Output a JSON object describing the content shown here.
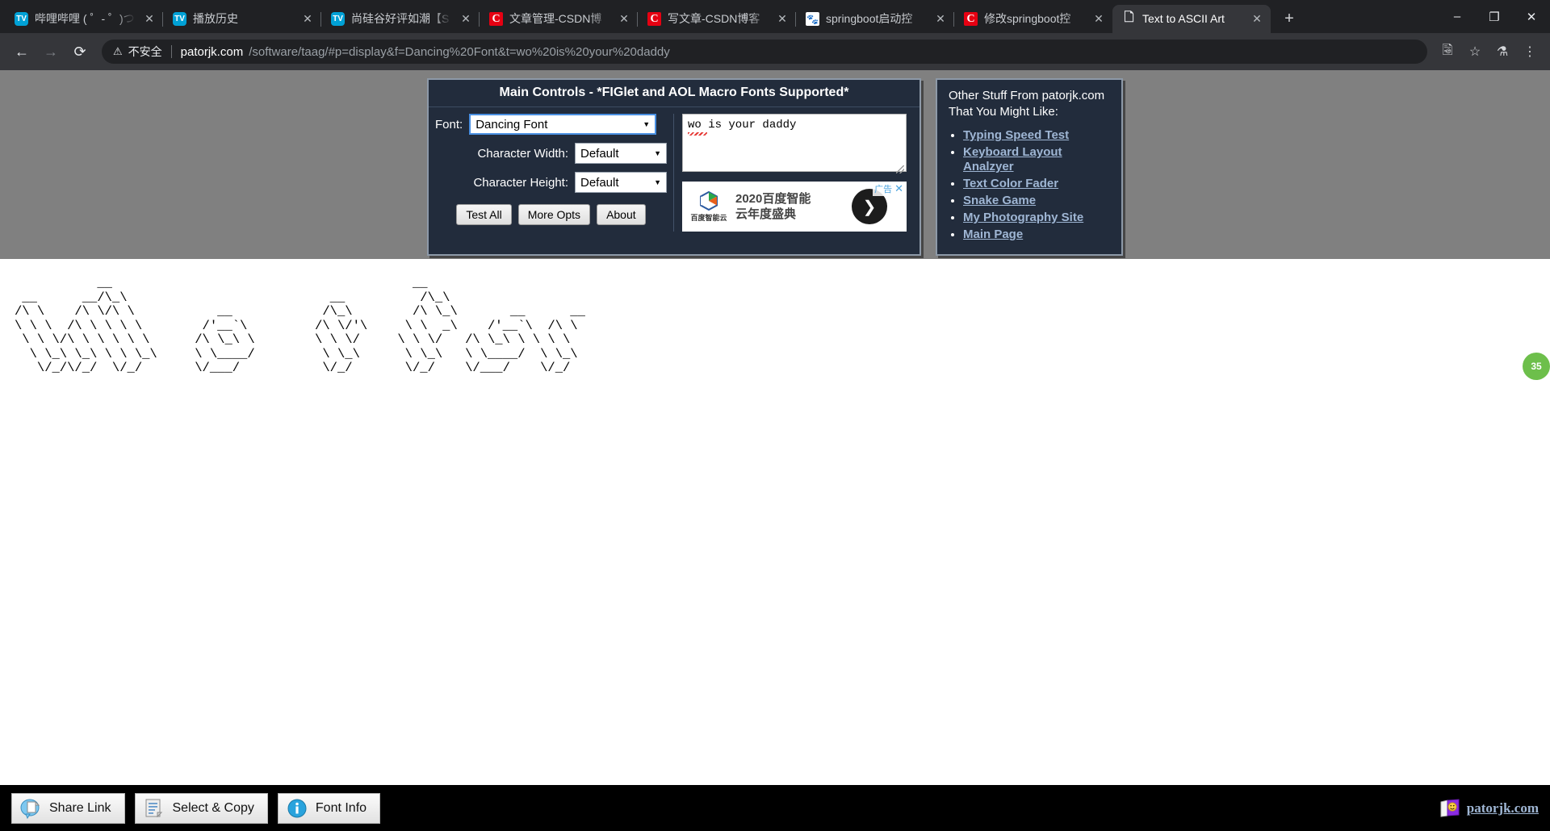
{
  "browser": {
    "tabs": [
      {
        "title": "哔哩哔哩 ( ゜- ゜)つ",
        "favicon": "bilibili-icon",
        "active": false
      },
      {
        "title": "播放历史",
        "favicon": "bilibili-icon",
        "active": false
      },
      {
        "title": "尚硅谷好评如潮【S",
        "favicon": "bilibili-icon",
        "active": false
      },
      {
        "title": "文章管理-CSDN博",
        "favicon": "csdn-icon",
        "active": false
      },
      {
        "title": "写文章-CSDN博客",
        "favicon": "csdn-icon",
        "active": false
      },
      {
        "title": "springboot启动控",
        "favicon": "baidu-icon",
        "active": false
      },
      {
        "title": "修改springboot控",
        "favicon": "csdn-icon",
        "active": false
      },
      {
        "title": "Text to ASCII Art",
        "favicon": "document-icon",
        "active": true
      }
    ],
    "close_label": "✕",
    "newtab_label": "+",
    "window_controls": [
      "–",
      "❐",
      "✕"
    ],
    "nav": {
      "back": "←",
      "forward": "→",
      "reload": "⟳"
    },
    "omnibox": {
      "warning_icon": "⚠",
      "security_label": "不安全",
      "host": "patorjk.com",
      "path": "/software/taag/#p=display&f=Dancing%20Font&t=wo%20is%20your%20daddy"
    },
    "toolbar_icons": [
      "translate-icon",
      "star-icon",
      "extensions-icon",
      "menu-icon"
    ]
  },
  "main_controls": {
    "title": "Main Controls - *FIGlet and AOL Macro Fonts Supported*",
    "font_label": "Font:",
    "font_value": "Dancing Font",
    "char_width_label": "Character Width:",
    "char_width_value": "Default",
    "char_height_label": "Character Height:",
    "char_height_value": "Default",
    "buttons": [
      {
        "label": "Test All"
      },
      {
        "label": "More Opts"
      },
      {
        "label": "About"
      }
    ],
    "input_text": "wo is your daddy"
  },
  "ad": {
    "logo_text": "百度智能云",
    "headline_line1": "2020百度智能",
    "headline_line2": "云年度盛典",
    "badge_label": "广告",
    "close_label": "✕",
    "arrow": "❯"
  },
  "other_stuff": {
    "title_line1": "Other Stuff From patorjk.com",
    "title_line2": "That You Might Like:",
    "links": [
      "Typing Speed Test",
      "Keyboard Layout Analzyer",
      "Text Color Fader",
      "Snake Game",
      "My Photography Site",
      "Main Page"
    ]
  },
  "art": {
    "text": "           __                                        __                        \n __      __/\\_\\                           __          /\\_\\                      \n/\\ \\    /\\ \\/\\ \\           __            /\\_\\        /\\ \\_\\       __      __    \n\\ \\ \\  /\\ \\ \\ \\ \\        /'__`\\         /\\ \\/'\\     \\ \\  _\\    /'__`\\  /\\ \\   \n \\ \\ \\/\\ \\ \\ \\ \\ \\      /\\ \\_\\ \\        \\ \\ \\/     \\ \\ \\/   /\\ \\_\\ \\ \\ \\ \\  \n  \\ \\_\\ \\_\\ \\ \\ \\_\\     \\ \\____/         \\ \\_\\      \\ \\_\\   \\ \\____/  \\ \\_\\ \n   \\/_/\\/_/  \\/_/       \\/___/           \\/_/       \\/_/    \\/___/    \\/_/ ",
    "scale_badge": "35"
  },
  "bottom_bar": {
    "buttons": [
      {
        "label": "Share Link",
        "icon": "share-link-icon"
      },
      {
        "label": "Select & Copy",
        "icon": "clipboard-icon"
      },
      {
        "label": "Font Info",
        "icon": "info-icon"
      }
    ],
    "brand": "patorjk.com"
  },
  "colors": {
    "panel_bg": "#222c3c",
    "panel_border": "#8d99a8",
    "band_gray": "#808080",
    "link_blue": "#9fb6d4",
    "ad_blue": "#4aa3df",
    "badge_green": "#6dbf4b"
  }
}
